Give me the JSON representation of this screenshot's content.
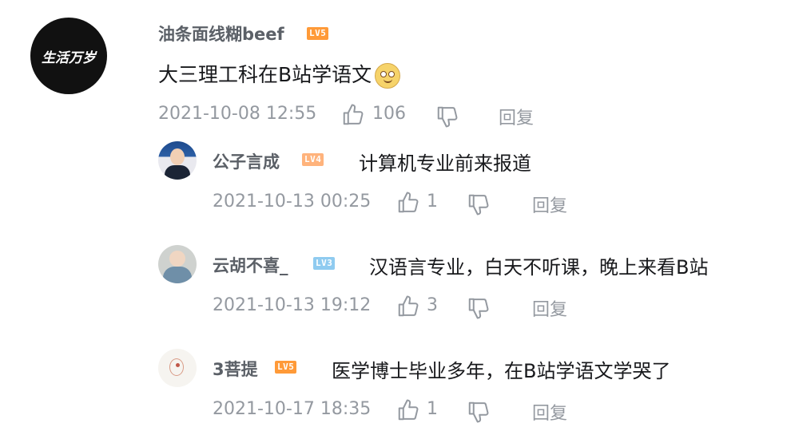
{
  "comment": {
    "avatar_text": "生活万岁",
    "username": "油条面线糊beef",
    "level": "LV5",
    "text": "大三理工科在B站学语文",
    "emoji": "dizzy-face-emoji",
    "timestamp": "2021-10-08 12:55",
    "likes": "106",
    "reply_label": "回复"
  },
  "replies": [
    {
      "username": "公子言成",
      "level": "LV4",
      "text": "计算机专业前来报道",
      "timestamp": "2021-10-13 00:25",
      "likes": "1",
      "reply_label": "回复"
    },
    {
      "username": "云胡不喜_",
      "level": "LV3",
      "text": "汉语言专业，白天不听课，晚上来看B站",
      "timestamp": "2021-10-13 19:12",
      "likes": "3",
      "reply_label": "回复"
    },
    {
      "username": "3菩提",
      "level": "LV5",
      "text": "医学博士毕业多年，在B站学语文学哭了",
      "timestamp": "2021-10-17 18:35",
      "likes": "1",
      "reply_label": "回复"
    }
  ],
  "colors": {
    "lv5": "#ff9a38",
    "lv4": "#ffb37c",
    "lv3": "#8fcbf0",
    "username": "#5b6067",
    "meta": "#9499a0",
    "content": "#18191c"
  },
  "icons": [
    "thumbs-up-icon",
    "thumbs-down-icon"
  ]
}
